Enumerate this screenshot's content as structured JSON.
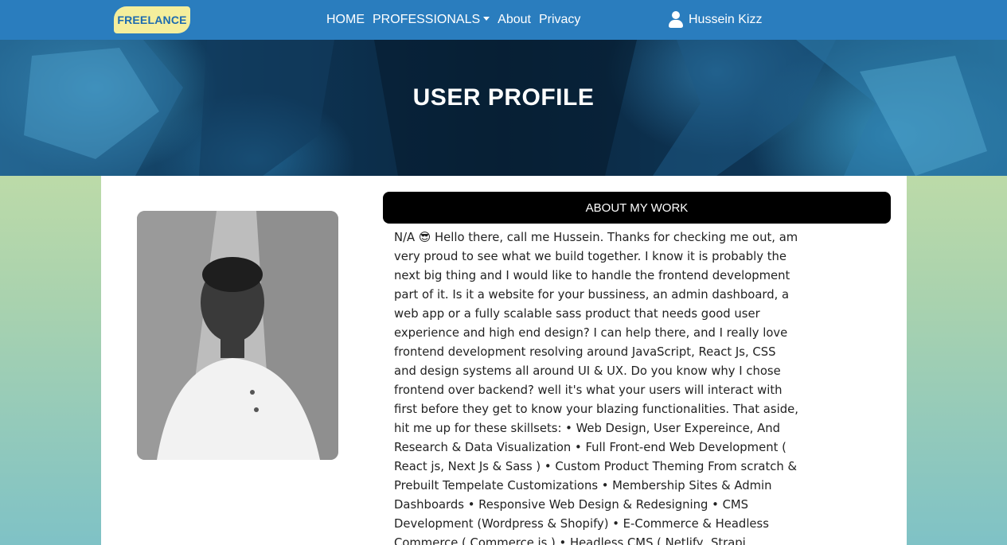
{
  "navbar": {
    "logo": "FREELANCE",
    "links": [
      "HOME",
      "PROFESSIONALS",
      "About",
      "Privacy"
    ],
    "user_name": "Hussein Kizz",
    "colors": {
      "bar": "#2a7dbe",
      "logo_bg": "#f4ee9c",
      "logo_text": "#1b6ab0"
    },
    "icons": {
      "dropdown": "caret-down-icon",
      "user": "user-icon"
    }
  },
  "hero": {
    "title": "USER PROFILE"
  },
  "profile": {
    "section_title": "ABOUT MY WORK",
    "about_text": "N/A 😎 Hello there, call me Hussein. Thanks for checking me out, am very proud to see what we build together. I know it is probably the next big thing and I would like to handle the frontend development part of it. Is it a website for your bussiness, an admin dashboard, a web app or a fully scalable sass product that needs good user experience and high end design? I can help there, and I really love frontend development resolving around JavaScript, React Js, CSS and design systems all around UI & UX. Do you know why I chose frontend over backend? well it's what your users will interact with first before they get to know your blazing functionalities. That aside, hit me up for these skillsets: • Web Design, User Expereince, And Research & Data Visualization • Full Front-end Web Development ( React js, Next Js & Sass ) • Custom Product Theming From scratch & Prebuilt Tempelate Customizations • Membership Sites & Admin Dashboards • Responsive Web Design & Redesigning • CMS Development (Wordpress & Shopify) • E-Commerce & Headless Commerce ( Commerce js ) • Headless CMS ( Netlify, Strapi, Contentful & Sanity ) • Firebase"
  }
}
